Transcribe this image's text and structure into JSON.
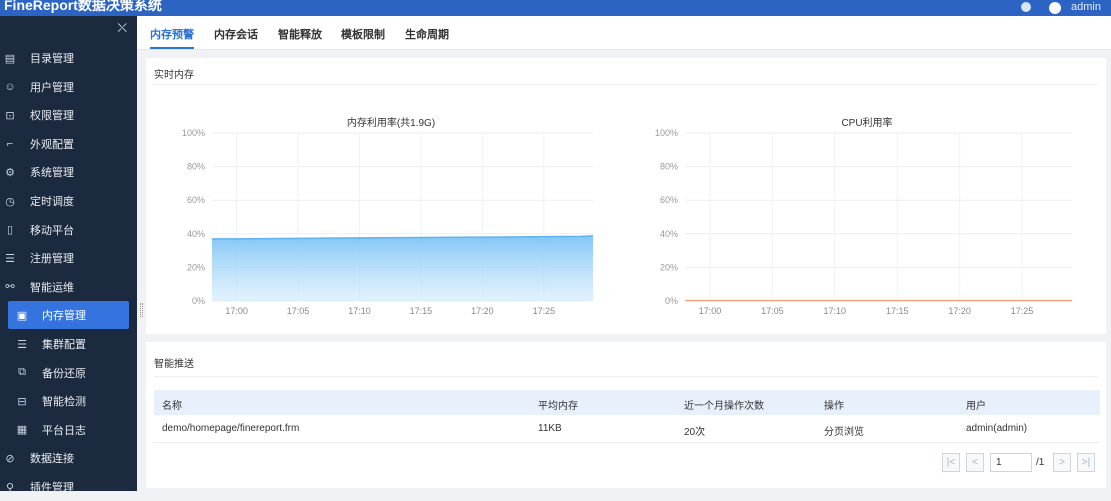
{
  "app": {
    "title": "FineReport数据决策系统",
    "user": "admin"
  },
  "sidebar": {
    "items": [
      {
        "label": "目录管理",
        "icon": "catalog-icon"
      },
      {
        "label": "用户管理",
        "icon": "user-icon"
      },
      {
        "label": "权限管理",
        "icon": "lock-icon"
      },
      {
        "label": "外观配置",
        "icon": "brush-icon"
      },
      {
        "label": "系统管理",
        "icon": "gear-icon"
      },
      {
        "label": "定时调度",
        "icon": "clock-icon"
      },
      {
        "label": "移动平台",
        "icon": "mobile-icon"
      },
      {
        "label": "注册管理",
        "icon": "register-icon"
      },
      {
        "label": "智能运维",
        "icon": "ops-icon"
      },
      {
        "label": "内存管理",
        "icon": "memory-icon",
        "active": true,
        "sub": true
      },
      {
        "label": "集群配置",
        "icon": "cluster-icon",
        "sub": true
      },
      {
        "label": "备份还原",
        "icon": "backup-icon",
        "sub": true
      },
      {
        "label": "智能检测",
        "icon": "monitor-icon",
        "sub": true
      },
      {
        "label": "平台日志",
        "icon": "log-icon",
        "sub": true
      },
      {
        "label": "数据连接",
        "icon": "link-icon"
      },
      {
        "label": "插件管理",
        "icon": "plugin-icon"
      }
    ]
  },
  "tabs": [
    "内存预警",
    "内存会话",
    "智能释放",
    "模板限制",
    "生命周期"
  ],
  "realtime": {
    "title": "实时内存",
    "memory_chart_title": "内存利用率(共1.9G)",
    "cpu_chart_title": "CPU利用率"
  },
  "chart_data": [
    {
      "type": "area",
      "title": "内存利用率(共1.9G)",
      "x": [
        "16:58",
        "17:00",
        "17:05",
        "17:10",
        "17:15",
        "17:20",
        "17:25",
        "17:28",
        "17:29"
      ],
      "x_ticks": [
        "17:00",
        "17:05",
        "17:10",
        "17:15",
        "17:20",
        "17:25"
      ],
      "y_ticks": [
        "0%",
        "20%",
        "40%",
        "60%",
        "80%",
        "100%"
      ],
      "values": [
        37,
        37,
        37.3,
        37.6,
        37.8,
        38,
        38.3,
        38.5,
        38.8
      ],
      "ylim": [
        0,
        100
      ],
      "color": "#7cc3f5",
      "grid": true
    },
    {
      "type": "line",
      "title": "CPU利用率",
      "x": [
        "16:58",
        "17:00",
        "17:05",
        "17:10",
        "17:15",
        "17:20",
        "17:25",
        "17:29"
      ],
      "x_ticks": [
        "17:00",
        "17:05",
        "17:10",
        "17:15",
        "17:20",
        "17:25"
      ],
      "y_ticks": [
        "0%",
        "20%",
        "40%",
        "60%",
        "80%",
        "100%"
      ],
      "values": [
        0.3,
        0.3,
        0.3,
        0.3,
        0.3,
        0.3,
        0.3,
        0.3
      ],
      "ylim": [
        0,
        100
      ],
      "color": "#f5a27a",
      "grid": true
    }
  ],
  "push": {
    "title": "智能推送",
    "columns": [
      "名称",
      "平均内存",
      "近一个月操作次数",
      "操作",
      "用户"
    ],
    "rows": [
      [
        "demo/homepage/finereport.frm",
        "11KB",
        "20次",
        "分页浏览",
        "admin(admin)"
      ]
    ]
  },
  "pager": {
    "current": "1",
    "total": "/1"
  },
  "colors": {
    "accent": "#2d72d9",
    "sidebar": "#1c2a3f",
    "topbar": "#2b64c2",
    "active_item": "#3573de"
  }
}
